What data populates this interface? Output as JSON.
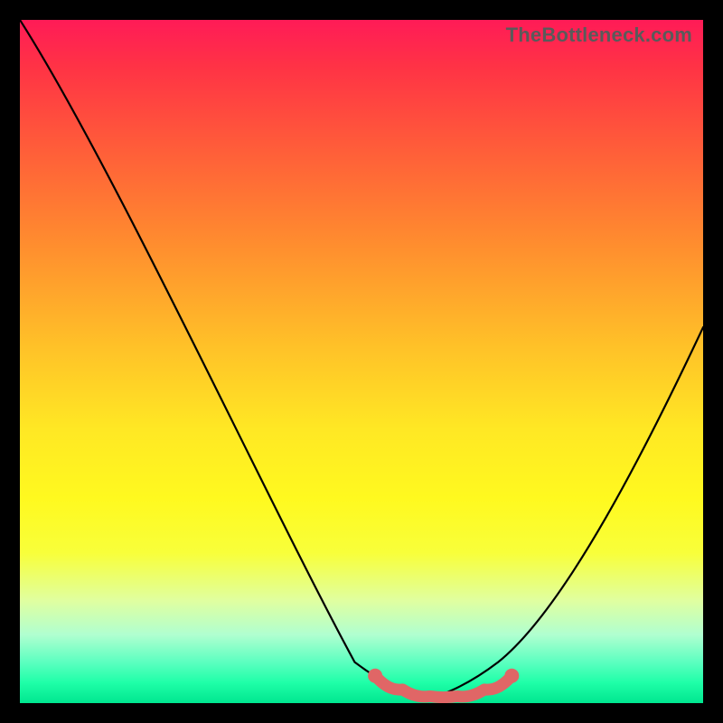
{
  "watermark": "TheBottleneck.com",
  "chart_data": {
    "type": "line",
    "title": "",
    "xlabel": "",
    "ylabel": "",
    "xlim": [
      0,
      100
    ],
    "ylim": [
      0,
      100
    ],
    "grid": false,
    "legend": false,
    "series": [
      {
        "name": "bottleneck-curve",
        "color": "#000000",
        "x": [
          0,
          4,
          8,
          12,
          16,
          20,
          24,
          28,
          32,
          36,
          40,
          44,
          48,
          52,
          56,
          60,
          64,
          68,
          72,
          76,
          80,
          84,
          88,
          92,
          96,
          100
        ],
        "y": [
          100,
          93,
          86,
          79,
          72,
          65,
          58,
          51,
          44,
          37,
          30,
          23,
          16,
          9,
          3,
          0,
          0,
          0,
          3,
          9,
          16,
          24,
          32,
          40,
          48,
          55
        ]
      }
    ],
    "marker_band": {
      "name": "optimal-band",
      "color": "#e06666",
      "x": [
        52,
        56,
        60,
        64,
        68,
        72
      ],
      "y": [
        3,
        1,
        0,
        0,
        1,
        3
      ]
    },
    "background_gradient": {
      "top": "#ff1b57",
      "mid": "#ffe824",
      "bottom": "#00e68f"
    }
  }
}
